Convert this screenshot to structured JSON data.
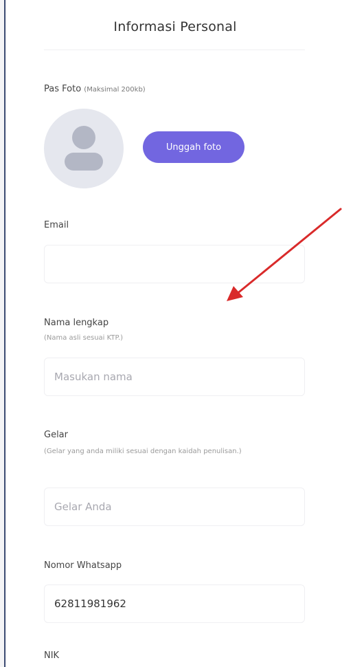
{
  "form": {
    "title": "Informasi Personal",
    "photo": {
      "label": "Pas Foto",
      "hint": "(Maksimal 200kb)",
      "upload_button": "Unggah foto"
    },
    "email": {
      "label": "Email",
      "value": "",
      "placeholder": ""
    },
    "full_name": {
      "label": "Nama lengkap",
      "hint": "(Nama asli sesuai KTP.)",
      "placeholder": "Masukan nama"
    },
    "degree": {
      "label": "Gelar",
      "hint": "(Gelar yang anda miliki sesuai dengan kaidah penulisan.)",
      "placeholder": "Gelar Anda"
    },
    "whatsapp": {
      "label": "Nomor Whatsapp",
      "value": "62811981962"
    },
    "nik": {
      "label": "NIK"
    }
  },
  "colors": {
    "accent": "#7266e0",
    "annotation_arrow": "#d92a2a"
  },
  "icons": {
    "avatar": "user-silhouette-icon",
    "annotation": "red-arrow-annotation"
  }
}
